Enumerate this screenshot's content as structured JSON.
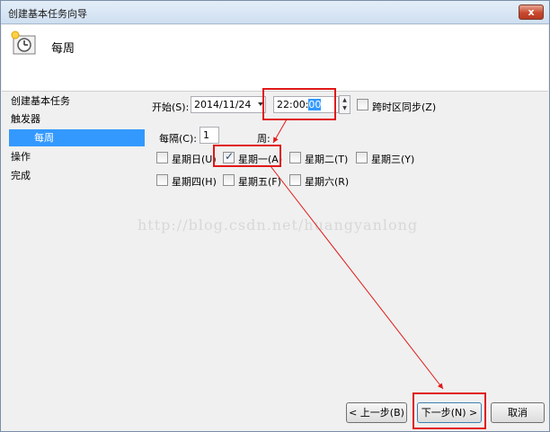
{
  "window": {
    "title": "创建基本任务向导",
    "close_label": "x"
  },
  "header": {
    "title": "每周",
    "icon": "clock-icon"
  },
  "sidebar": {
    "items": [
      {
        "label": "创建基本任务"
      },
      {
        "label": "触发器"
      },
      {
        "label": "每周"
      },
      {
        "label": "操作"
      },
      {
        "label": "完成"
      }
    ]
  },
  "form": {
    "start_label": "开始(S):",
    "start_date": "2014/11/24",
    "time_prefix": "22:00:",
    "time_selected": "00",
    "sync_label": "跨时区同步(Z)",
    "recur_label": "每隔(C):",
    "recur_value": "1",
    "recur_unit": "周:",
    "days": [
      {
        "label": "星期日(U)",
        "checked": false
      },
      {
        "label": "星期一(A)",
        "checked": true
      },
      {
        "label": "星期二(T)",
        "checked": false
      },
      {
        "label": "星期三(Y)",
        "checked": false
      },
      {
        "label": "星期四(H)",
        "checked": false
      },
      {
        "label": "星期五(F)",
        "checked": false
      },
      {
        "label": "星期六(R)",
        "checked": false
      }
    ]
  },
  "buttons": {
    "back": "< 上一步(B)",
    "next": "下一步(N) >",
    "cancel": "取消"
  },
  "watermark": "http://blog.csdn.net/huangyanlong",
  "colors": {
    "highlight": "#e01818",
    "selection": "#3399ff"
  }
}
